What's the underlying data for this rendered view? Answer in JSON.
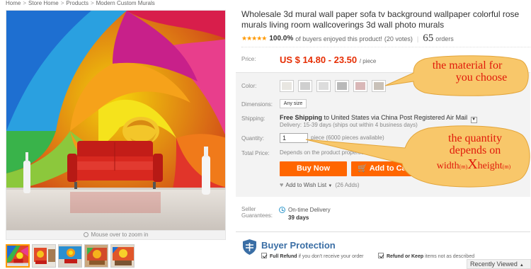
{
  "breadcrumb": [
    "Home",
    "Store Home",
    "Products",
    "Modern Custom Murals"
  ],
  "gallery": {
    "zoom_hint": "Mouse over to zoom in",
    "thumbnail_count": 5
  },
  "product": {
    "title": "Wholesale 3d mural wall paper sofa tv background wallpaper colorful rose murals living room wallcoverings 3d wall photo murals",
    "rating_percent": "100.0%",
    "rating_text": "of buyers enjoyed this product!",
    "votes": "(20 votes)",
    "orders_count": "65",
    "orders_label": "orders"
  },
  "price": {
    "label": "Price:",
    "value": "US $ 14.80 - 23.50",
    "unit": "/ piece"
  },
  "options": {
    "color_label": "Color:",
    "swatch_colors": [
      "#e8e6e1",
      "#cfcfcf",
      "#dcdcdc",
      "#b9b9b9",
      "#d9b7b7",
      "#c9c1b8"
    ],
    "dimensions_label": "Dimensions:",
    "dimensions_value": "Any size"
  },
  "shipping": {
    "label": "Shipping:",
    "free": "Free Shipping",
    "dest": "to United States via China Post Registered Air Mail",
    "delivery": "Delivery: 15-39 days (ships out within 4 business days)"
  },
  "quantity": {
    "label": "Quantity:",
    "value": "1",
    "available": "piece (6000 pieces available)"
  },
  "total": {
    "label": "Total Price:",
    "text": "Depends on the product properties you select"
  },
  "actions": {
    "buy_now": "Buy Now",
    "add_to_cart": "Add to Cart",
    "wish_list": "Add to Wish List",
    "wish_count": "(26 Adds)"
  },
  "seller": {
    "label_line1": "Seller",
    "label_line2": "Guarantees:",
    "ontime": "On-time Delivery",
    "days": "39 days"
  },
  "protection": {
    "title": "Buyer Protection",
    "item1_bold": "Full Refund",
    "item1_rest": "if you don't receive your order",
    "item2_bold": "Refund or Keep",
    "item2_rest": "items not as described"
  },
  "recently_viewed": "Recently Viewed",
  "callouts": {
    "material_line1": "the material for",
    "material_line2": "you choose",
    "qty_line1": "the quantity",
    "qty_line2": "depends on",
    "qty_line3_a": "width",
    "qty_line3_unit1": "(m)",
    "qty_line3_x": "X",
    "qty_line3_b": "height",
    "qty_line3_unit2": "(m)",
    "bubble_color": "#f8c76a"
  },
  "colors": {
    "price_red": "#e62e04",
    "button_orange": "#ff6600",
    "protection_blue": "#3a6ea5"
  }
}
